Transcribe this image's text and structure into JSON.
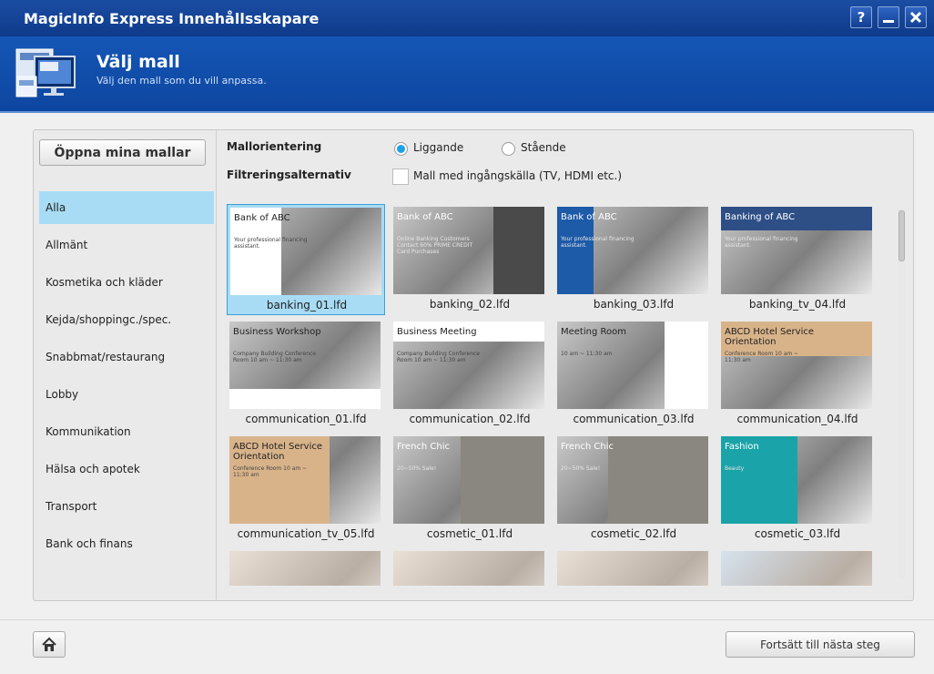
{
  "window": {
    "title": "MagicInfo Express Innehållsskapare",
    "buttons": [
      {
        "name": "help",
        "label": "?"
      },
      {
        "name": "minimize",
        "label": "—"
      },
      {
        "name": "close",
        "label": "✕"
      }
    ]
  },
  "header": {
    "title": "Välj mall",
    "subtitle": "Välj den mall som du vill anpassa."
  },
  "sidebar": {
    "open_button": "Öppna mina mallar",
    "selected_index": 0,
    "items": [
      {
        "label": "Alla"
      },
      {
        "label": "Allmänt"
      },
      {
        "label": "Kosmetika och kläder"
      },
      {
        "label": "Kejda/shoppingc./spec."
      },
      {
        "label": "Snabbmat/restaurang"
      },
      {
        "label": "Lobby"
      },
      {
        "label": "Kommunikation"
      },
      {
        "label": "Hälsa och apotek"
      },
      {
        "label": "Transport"
      },
      {
        "label": "Bank och finans"
      }
    ]
  },
  "options": {
    "orientation_label": "Mallorientering",
    "orientation_landscape": "Liggande",
    "orientation_portrait": "Stående",
    "orientation_selected": "landscape",
    "filter_label": "Filtreringsalternativ",
    "filter_source": "Mall med ingångskälla (TV, HDMI etc.)",
    "filter_source_checked": false
  },
  "templates": [
    {
      "file": "banking_01.lfd",
      "selected": true,
      "caption": "Bank of ABC",
      "note": "Your professional financing assistant.",
      "accent": "#ffffff"
    },
    {
      "file": "banking_02.lfd",
      "selected": false,
      "caption": "Bank of ABC",
      "note": "Online Banking Customers Contact 60% PRIME CREDIT Card Purchases",
      "accent": "#4a4a4a"
    },
    {
      "file": "banking_03.lfd",
      "selected": false,
      "caption": "Bank of ABC",
      "note": "Your professional financing assistant.",
      "accent": "#1d5aa8"
    },
    {
      "file": "banking_tv_04.lfd",
      "selected": false,
      "caption": "Banking of ABC",
      "note": "Your professional financing assistant.",
      "accent": "#2d4f86"
    },
    {
      "file": "communication_01.lfd",
      "selected": false,
      "caption": "Business Workshop",
      "note": "Company Building Conference Room 10 am ~ 11:30 am",
      "accent": "#ffffff"
    },
    {
      "file": "communication_02.lfd",
      "selected": false,
      "caption": "Business Meeting",
      "note": "Company Building Conference Room 10 am ~ 11:30 am",
      "accent": "#ffffff"
    },
    {
      "file": "communication_03.lfd",
      "selected": false,
      "caption": "Meeting Room",
      "note": "10 am ~ 11:30 am",
      "accent": "#ffffff"
    },
    {
      "file": "communication_04.lfd",
      "selected": false,
      "caption": "ABCD Hotel Service Orientation",
      "note": "Conference Room 10 am ~ 11:30 am",
      "accent": "#d8b38a"
    },
    {
      "file": "communication_tv_05.lfd",
      "selected": false,
      "caption": "ABCD Hotel Service Orientation",
      "note": "Conference Room 10 am ~ 11:30 am",
      "accent": "#d8b38a"
    },
    {
      "file": "cosmetic_01.lfd",
      "selected": false,
      "caption": "French Chic",
      "note": "20~50% Sale!",
      "accent": "#8a8680"
    },
    {
      "file": "cosmetic_02.lfd",
      "selected": false,
      "caption": "French Chic",
      "note": "20~50% Sale!",
      "accent": "#8a8680"
    },
    {
      "file": "cosmetic_03.lfd",
      "selected": false,
      "caption": "Fashion",
      "note": "Beauty",
      "accent": "#1aa3a8"
    },
    {
      "file": "",
      "selected": false,
      "caption": "",
      "note": "",
      "accent": "#e9e0d6"
    },
    {
      "file": "",
      "selected": false,
      "caption": "",
      "note": "",
      "accent": "#e9e0d6"
    },
    {
      "file": "",
      "selected": false,
      "caption": "",
      "note": "",
      "accent": "#e9e0d6"
    },
    {
      "file": "",
      "selected": false,
      "caption": "",
      "note": "",
      "accent": "#d6e2ee"
    }
  ],
  "footer": {
    "home_icon": "home-icon",
    "next_button": "Fortsätt till nästa steg"
  },
  "colors": {
    "titlebar": "#1a4da3",
    "header": "#1556b5",
    "selection": "#a8dcf4",
    "radio_on": "#1ea2e6"
  }
}
